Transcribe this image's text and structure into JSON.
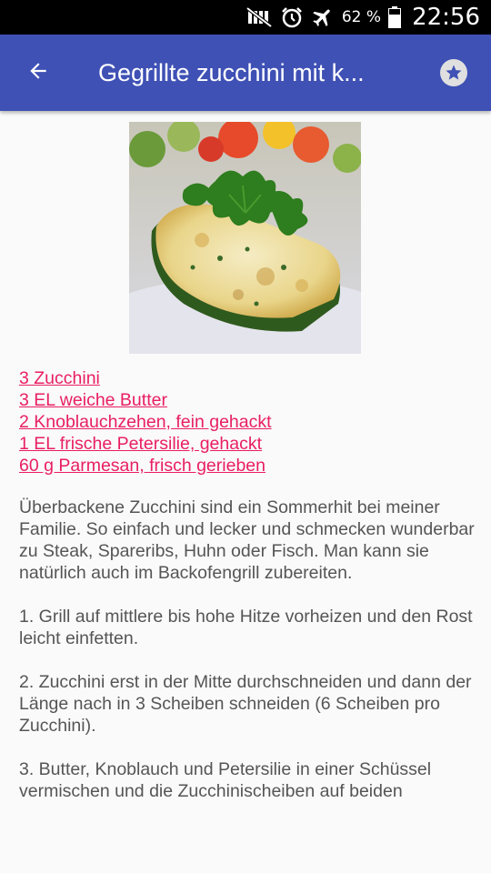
{
  "status_bar": {
    "battery_percent": "62 %",
    "time": "22:56",
    "icons": [
      "mute-icon",
      "alarm-icon",
      "airplane-mode-icon",
      "battery-icon"
    ]
  },
  "app_bar": {
    "title": "Gegrillte zucchini mit k...",
    "back_icon": "arrow-back-icon",
    "favorite_icon": "star-icon"
  },
  "recipe": {
    "image": "grilled-zucchini-photo",
    "ingredients": [
      "3 Zucchini",
      "3 EL weiche Butter",
      "2 Knoblauchzehen, fein gehackt",
      "1 EL frische Petersilie, gehackt",
      "60 g Parmesan, frisch gerieben"
    ],
    "paragraphs": [
      "Überbackene Zucchini sind ein Sommerhit bei meiner Familie. So einfach und lecker und schmecken wunderbar zu Steak, Spareribs, Huhn oder Fisch. Man kann sie natürlich auch im Backofengrill zubereiten.",
      "1. Grill auf mittlere bis hohe Hitze vorheizen und den Rost leicht einfetten.",
      "2. Zucchini erst in der Mitte durchschneiden und dann der Länge nach in 3 Scheiben schneiden (6 Scheiben pro Zucchini).",
      "3. Butter, Knoblauch und Petersilie in einer Schüssel vermischen und die Zucchinischeiben auf beiden"
    ]
  },
  "colors": {
    "app_bar": "#3f51b5",
    "link": "#e91e63",
    "text": "#555555",
    "background": "#fafafa"
  }
}
